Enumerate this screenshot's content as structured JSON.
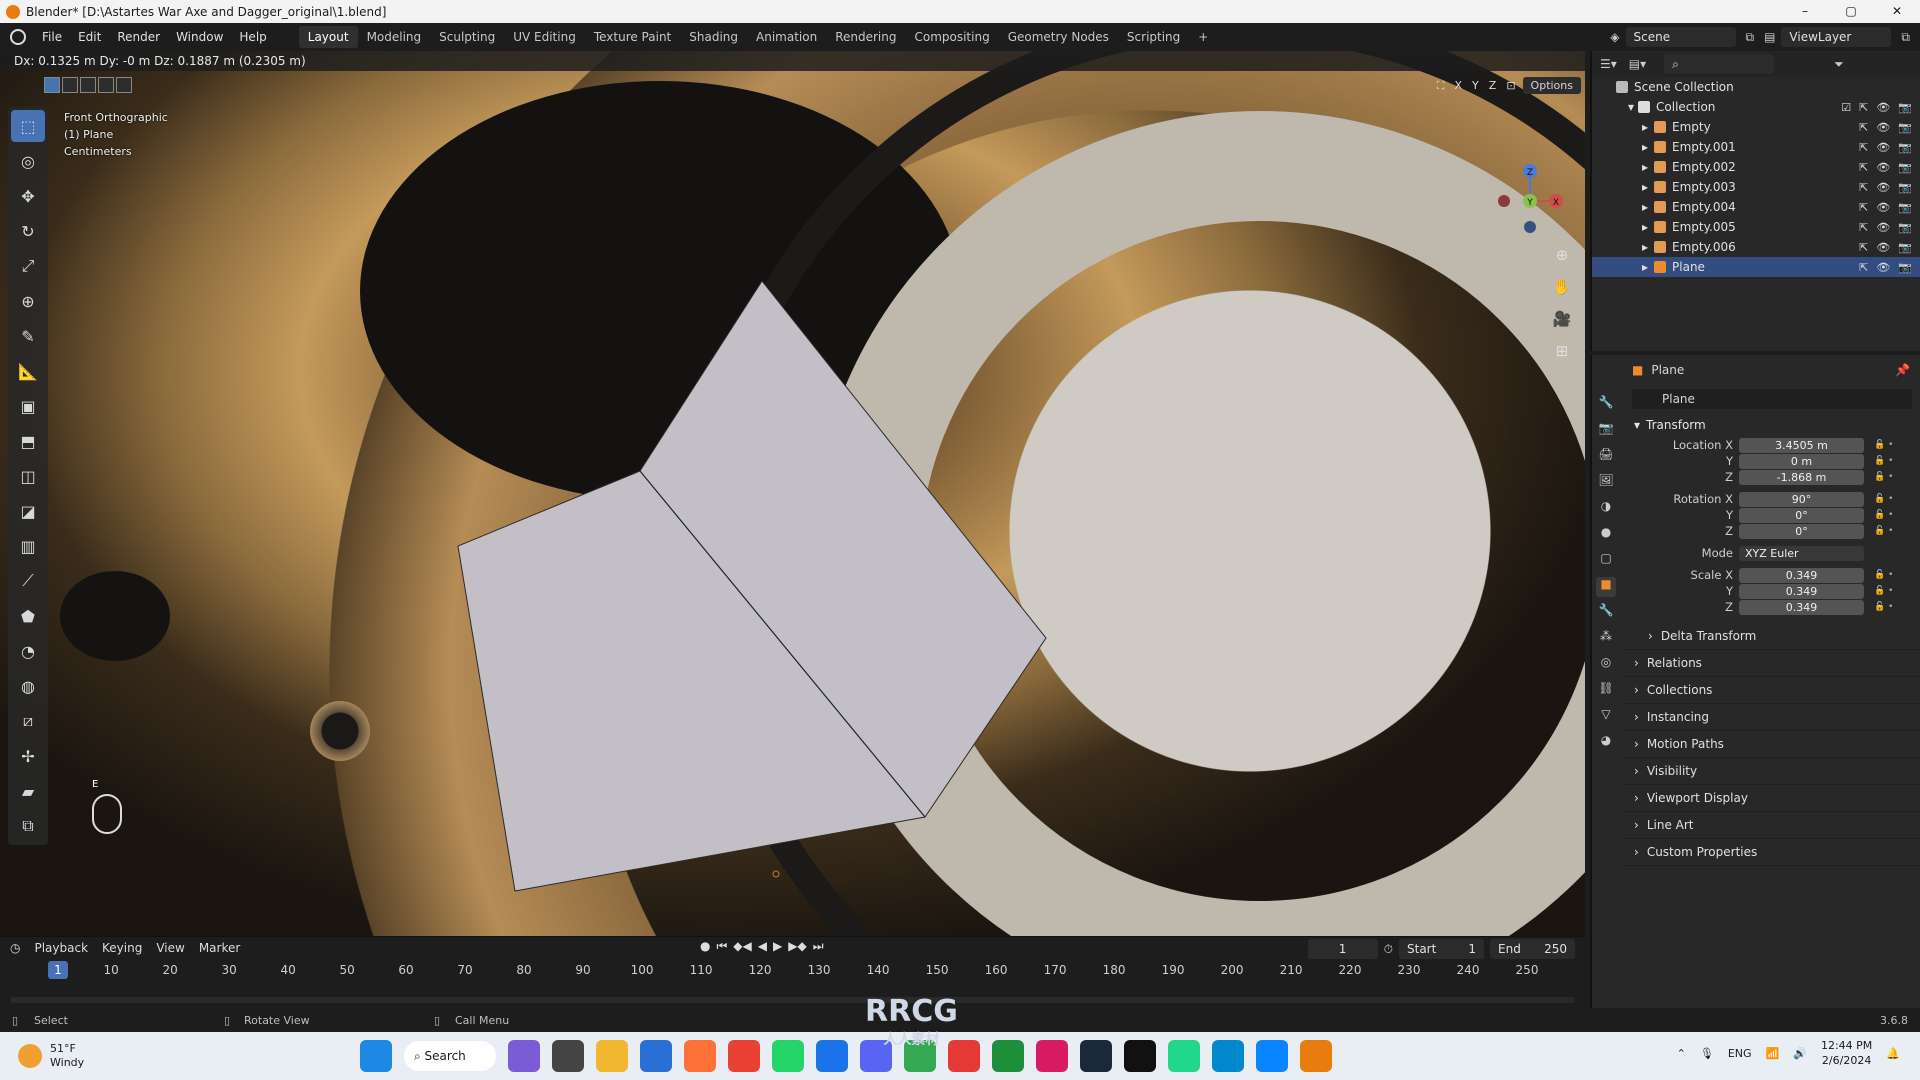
{
  "window": {
    "title": "Blender* [D:\\Astartes War Axe and Dagger_original\\1.blend]",
    "min": "–",
    "max": "▢",
    "close": "✕"
  },
  "menus": [
    "File",
    "Edit",
    "Render",
    "Window",
    "Help"
  ],
  "workspaces": [
    "Layout",
    "Modeling",
    "Sculpting",
    "UV Editing",
    "Texture Paint",
    "Shading",
    "Animation",
    "Rendering",
    "Compositing",
    "Geometry Nodes",
    "Scripting",
    "+"
  ],
  "active_workspace": "Layout",
  "scene": "Scene",
  "view_layer": "ViewLayer",
  "viewport": {
    "header_status": "Dx: 0.1325 m  Dy: -0 m  Dz: 0.1887 m (0.2305 m)",
    "view_name": "Front Orthographic",
    "object_info": "(1) Plane",
    "units": "Centimeters",
    "axes": [
      "X",
      "Y",
      "Z"
    ],
    "options": "Options",
    "gizmo": {
      "z": "Z",
      "y": "Y",
      "x": "X"
    },
    "shortcut_hint": "E"
  },
  "tools": [
    "select-box",
    "cursor",
    "move",
    "rotate",
    "scale",
    "transform",
    "annotate",
    "measure",
    "add-cube",
    "extrude",
    "inset",
    "bevel",
    "loop-cut",
    "knife",
    "poly-build",
    "spin",
    "smooth",
    "edge-slide",
    "shrink",
    "shear",
    "rip"
  ],
  "timeline": {
    "menus": [
      "Playback",
      "Keying",
      "View",
      "Marker"
    ],
    "current_frame": "1",
    "start_label": "Start",
    "start": "1",
    "end_label": "End",
    "end": "250",
    "ticks": [
      "1",
      "10",
      "20",
      "30",
      "40",
      "50",
      "60",
      "70",
      "80",
      "90",
      "100",
      "110",
      "120",
      "130",
      "140",
      "150",
      "160",
      "170",
      "180",
      "190",
      "200",
      "210",
      "220",
      "230",
      "240",
      "250"
    ]
  },
  "statusbar": {
    "select": "Select",
    "rotate": "Rotate View",
    "menu": "Call Menu",
    "version": "3.6.8"
  },
  "outliner": {
    "root": "Scene Collection",
    "collection": "Collection",
    "items": [
      "Empty",
      "Empty.001",
      "Empty.002",
      "Empty.003",
      "Empty.004",
      "Empty.005",
      "Empty.006",
      "Plane"
    ],
    "selected": "Plane"
  },
  "properties": {
    "context": "Plane",
    "object_name": "Plane",
    "panel": "Transform",
    "location_label": "Location X",
    "location": [
      "3.4505 m",
      "0 m",
      "-1.868 m"
    ],
    "rotation_label": "Rotation X",
    "rotation": [
      "90°",
      "0°",
      "0°"
    ],
    "mode_label": "Mode",
    "mode": "XYZ Euler",
    "scale_label": "Scale X",
    "scale": [
      "0.349",
      "0.349",
      "0.349"
    ],
    "y_label": "Y",
    "z_label": "Z",
    "subpanels": [
      "Delta Transform",
      "Relations",
      "Collections",
      "Instancing",
      "Motion Paths",
      "Visibility",
      "Viewport Display",
      "Line Art",
      "Custom Properties"
    ]
  },
  "taskbar": {
    "temp": "51°F",
    "weather": "Windy",
    "search": "Search",
    "lang": "ENG",
    "time": "12:44 PM",
    "date": "2/6/2024",
    "watermark": "RRCG",
    "watermark_sub": "人人素材"
  },
  "colors": {
    "accent": "#4772b3",
    "selected_row": "#334d80",
    "orange": "#e87d0d"
  }
}
